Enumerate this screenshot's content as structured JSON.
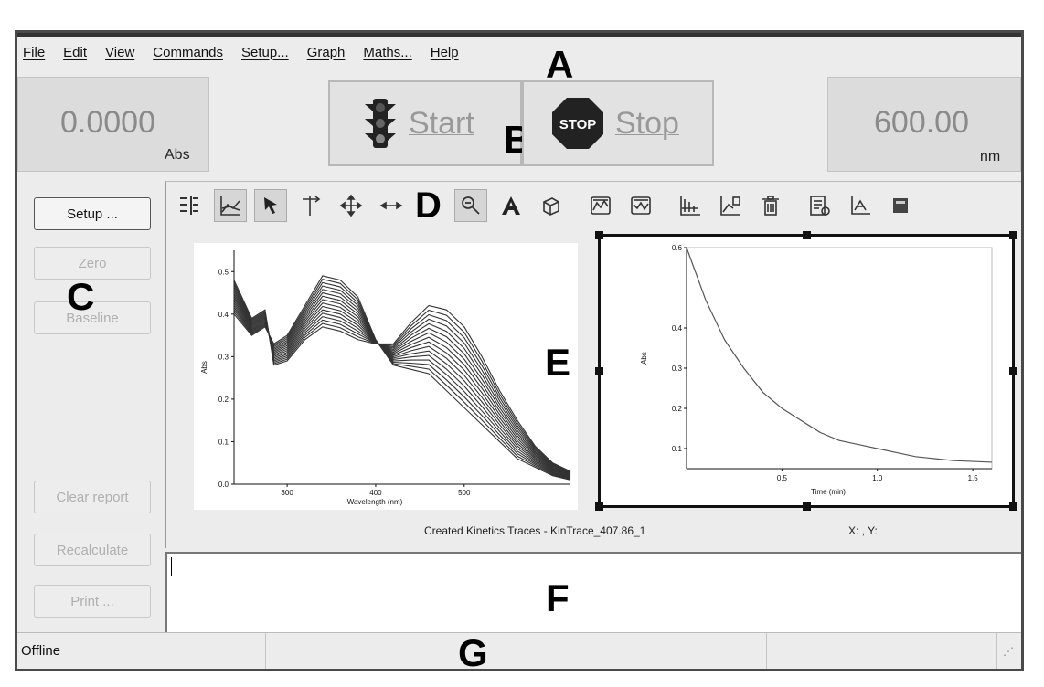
{
  "menu": [
    "File",
    "Edit",
    "View",
    "Commands",
    "Setup...",
    "Graph",
    "Maths...",
    "Help"
  ],
  "callouts": {
    "a": "A",
    "b": "B",
    "c": "C",
    "d": "D",
    "e": "E",
    "f": "F",
    "g": "G"
  },
  "absorbance": {
    "value": "0.0000",
    "unit": "Abs"
  },
  "wavelength": {
    "value": "600.00",
    "unit": "nm"
  },
  "start_label": "Start",
  "stop_label": "Stop",
  "stop_sign_text": "STOP",
  "side_buttons": {
    "setup": "Setup ...",
    "zero": "Zero",
    "baseline": "Baseline",
    "clear_report": "Clear report",
    "recalculate": "Recalculate",
    "print": "Print ..."
  },
  "toolbar_icons": [
    "legend-icon",
    "graph-type-icon",
    "pointer-icon",
    "cursor-icon",
    "pan-icon",
    "stretch-icon",
    "zoom-icon",
    "text-icon",
    "object-icon",
    "copy-graph-icon",
    "paste-graph-icon",
    "kinetics-icon",
    "extract-icon",
    "delete-icon",
    "report-icon",
    "axis-icon",
    "more-icon"
  ],
  "status_text": "Created Kinetics Traces - KinTrace_407.86_1",
  "coord_text": "X: , Y:",
  "status": {
    "state": "Offline"
  },
  "colors": {
    "trace": "#333333",
    "decay": "#555555",
    "disabled_text": "#b0b0b0"
  },
  "chart_data": [
    {
      "type": "line",
      "xlabel": "Wavelength (nm)",
      "ylabel": "Abs",
      "xlim": [
        240,
        620
      ],
      "ylim": [
        0.0,
        0.55
      ],
      "xticks": [
        "300",
        "400",
        "500"
      ],
      "yticks": [
        "0.0",
        "0.1",
        "0.2",
        "0.3",
        "0.4",
        "0.5"
      ],
      "series_count": 16,
      "series_profile": {
        "x": [
          240,
          260,
          275,
          285,
          300,
          320,
          340,
          360,
          380,
          400,
          420,
          440,
          460,
          480,
          500,
          520,
          540,
          560,
          580,
          600,
          620
        ],
        "first": [
          0.4,
          0.35,
          0.37,
          0.33,
          0.35,
          0.42,
          0.49,
          0.48,
          0.44,
          0.34,
          0.28,
          0.27,
          0.26,
          0.22,
          0.18,
          0.14,
          0.1,
          0.06,
          0.04,
          0.02,
          0.01
        ],
        "last": [
          0.48,
          0.39,
          0.41,
          0.28,
          0.29,
          0.34,
          0.37,
          0.36,
          0.34,
          0.33,
          0.33,
          0.38,
          0.42,
          0.41,
          0.37,
          0.3,
          0.22,
          0.15,
          0.09,
          0.05,
          0.03
        ]
      }
    },
    {
      "type": "line",
      "xlabel": "Time (min)",
      "ylabel": "Abs",
      "xlim": [
        0.0,
        1.6
      ],
      "ylim": [
        0.05,
        0.6
      ],
      "xticks": [
        "0.5",
        "1.0",
        "1.5"
      ],
      "yticks": [
        "0.1",
        "0.2",
        "0.3",
        "0.4",
        "0.6"
      ],
      "x": [
        0,
        0.1,
        0.2,
        0.3,
        0.4,
        0.5,
        0.6,
        0.7,
        0.8,
        0.9,
        1.0,
        1.1,
        1.2,
        1.3,
        1.4,
        1.5,
        1.6
      ],
      "y": [
        0.6,
        0.47,
        0.37,
        0.3,
        0.24,
        0.2,
        0.17,
        0.14,
        0.12,
        0.11,
        0.1,
        0.09,
        0.08,
        0.075,
        0.07,
        0.068,
        0.066
      ]
    }
  ]
}
